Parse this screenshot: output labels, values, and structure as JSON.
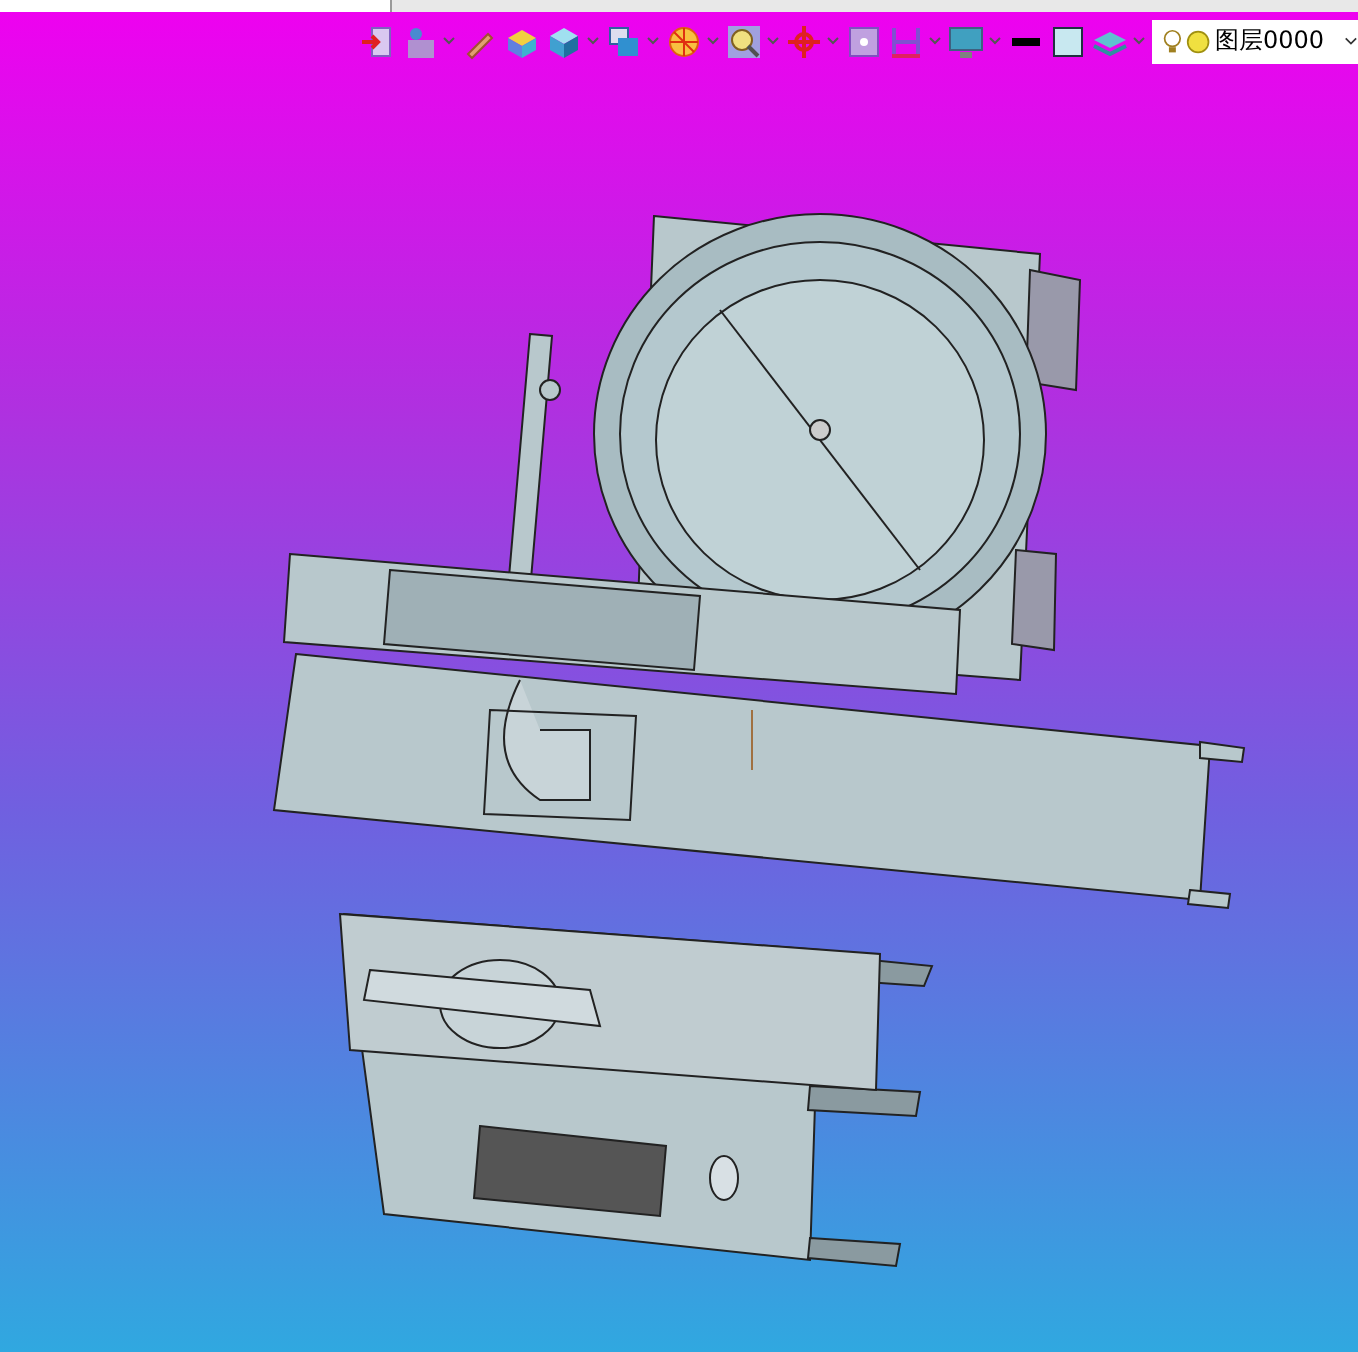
{
  "toolbar": {
    "tools": [
      {
        "kind": "exit",
        "dropdown": false
      },
      {
        "kind": "view",
        "dropdown": true
      },
      {
        "kind": "pencil",
        "dropdown": false
      },
      {
        "kind": "solid",
        "dropdown": false
      },
      {
        "kind": "cube",
        "dropdown": true
      },
      {
        "kind": "viewbox",
        "dropdown": true
      },
      {
        "kind": "pie",
        "dropdown": true
      },
      {
        "kind": "zoom",
        "dropdown": true
      },
      {
        "kind": "pan",
        "dropdown": true
      },
      {
        "kind": "fit",
        "dropdown": false
      },
      {
        "kind": "measure",
        "dropdown": true
      },
      {
        "kind": "display",
        "dropdown": true
      },
      {
        "kind": "linecolor",
        "dropdown": false
      },
      {
        "kind": "fillcolor",
        "dropdown": false
      },
      {
        "kind": "layers",
        "dropdown": true
      }
    ],
    "layer": {
      "name": "图层0000"
    }
  }
}
